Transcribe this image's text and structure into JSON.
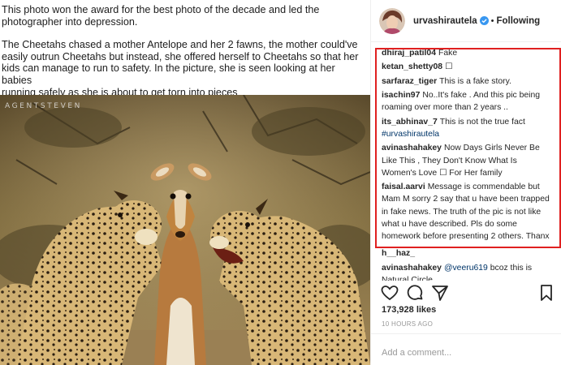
{
  "post": {
    "caption_lines": [
      "This photo won the award for the best photo of the decade and led the",
      "photographer into depression."
    ],
    "body_lines": [
      "The Cheetahs chased a mother Antelope and her 2 fawns, the mother could've",
      "easily outrun Cheetahs but instead, she offered herself to Cheetahs so that her",
      "kids can manage to run to safety. In the picture, she is seen looking at her babies",
      "running safely as she is about to get torn into pieces"
    ],
    "watermark": "AGENTSTEVEN"
  },
  "header": {
    "username": "urvashirautela",
    "separator": "•",
    "follow_label": "Following",
    "verified_icon": "verified-badge-icon",
    "verified_color": "#3897f0"
  },
  "comments": [
    {
      "user": "dhiraj_patil04",
      "text": "Fake"
    },
    {
      "user": "ketan_shetty08",
      "text": "☐"
    },
    {
      "user": "sarfaraz_tiger",
      "text": "This is a fake story."
    },
    {
      "user": "isachin97",
      "text": "No..It's fake . And this pic being roaming over more than 2 years .."
    },
    {
      "user": "its_abhinav_7",
      "text": "This is not the true fact",
      "tag": "#urvashirautela"
    },
    {
      "user": "avinashahakey",
      "text": "Now Days Girls Never Be Like This , They Don't Know What Is Women's Love ☐ For Her family"
    },
    {
      "user": "faisal.aarvi",
      "text": "Message is commendable but Mam M sorry 2 say that u have been trapped in fake news. The truth of the pic is not like what u have described. Pls do some homework before presenting 2 others. Thanx"
    },
    {
      "user": "h__haz_",
      "text": ""
    },
    {
      "user": "avinashahakey",
      "mention": "@veeru619",
      "text": "bcoz this is Natural Circle"
    }
  ],
  "actions": {
    "like_icon": "heart-icon",
    "comment_icon": "comment-icon",
    "share_icon": "share-icon",
    "save_icon": "bookmark-icon"
  },
  "likes": "173,928 likes",
  "timestamp": "10 HOURS AGO",
  "add_comment": {
    "placeholder": "Add a comment..."
  },
  "colors": {
    "highlight": "#e02020",
    "link": "#003569",
    "border": "#efefef"
  }
}
